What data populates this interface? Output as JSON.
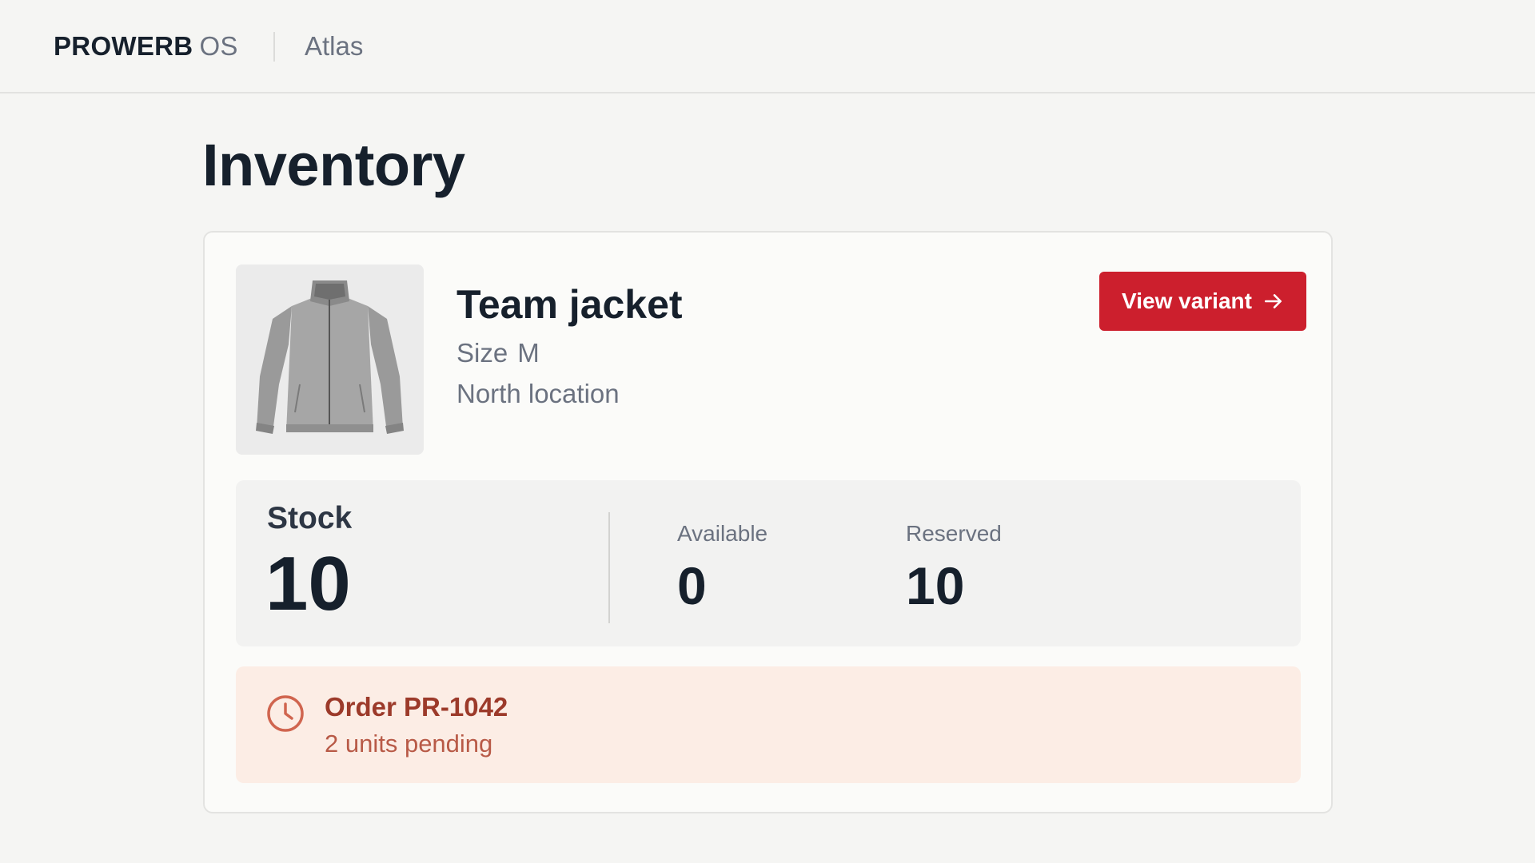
{
  "header": {
    "brand_bold": "PROWERB",
    "brand_light": "OS",
    "app_name": "Atlas"
  },
  "page": {
    "title": "Inventory"
  },
  "product": {
    "name": "Team jacket",
    "size_label": "Size",
    "size_value": "M",
    "location": "North location",
    "image_icon": "jacket-image"
  },
  "actions": {
    "view_variant_label": "View variant",
    "view_variant_icon": "arrow-right-icon"
  },
  "stock": {
    "label": "Stock",
    "value": "10",
    "available_label": "Available",
    "available_value": "0",
    "reserved_label": "Reserved",
    "reserved_value": "10"
  },
  "alert": {
    "icon": "clock-icon",
    "title": "Order PR-1042",
    "subtitle": "2 units pending"
  },
  "colors": {
    "accent": "#cc1f2d",
    "alert_bg": "#fcede5",
    "alert_text": "#9c3a2a",
    "text_primary": "#16202c",
    "text_secondary": "#6b7280"
  }
}
